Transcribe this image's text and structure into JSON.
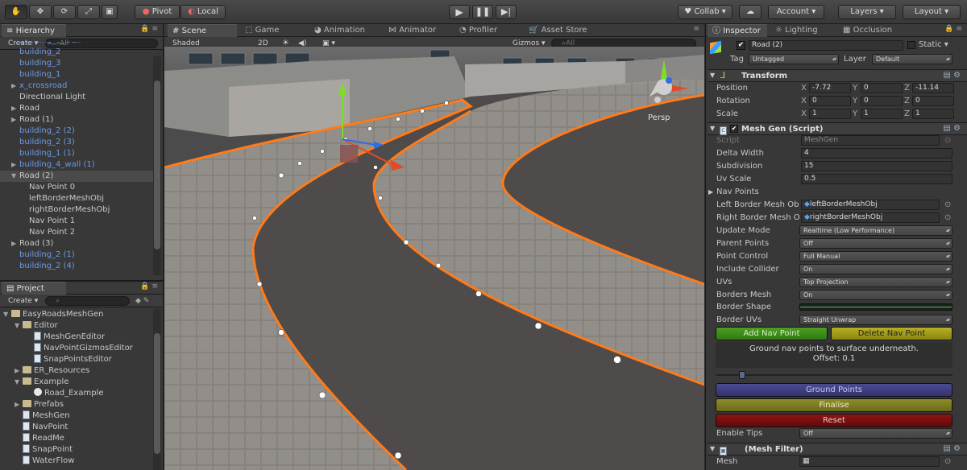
{
  "toolbar": {
    "tools": [
      "hand-icon",
      "move-icon",
      "rotate-icon",
      "scale-icon",
      "rect-icon"
    ],
    "pivot": "Pivot",
    "local": "Local",
    "collab": "Collab",
    "account": "Account",
    "layers": "Layers",
    "layout": "Layout"
  },
  "hierarchy": {
    "tab": "Hierarchy",
    "create": "Create",
    "search_placeholder": "All",
    "items": [
      {
        "label": "building_4_wall",
        "indent": 0,
        "blue": true,
        "fold": ""
      },
      {
        "label": "building_2",
        "indent": 0,
        "blue": true,
        "fold": ""
      },
      {
        "label": "building_3",
        "indent": 0,
        "blue": true,
        "fold": ""
      },
      {
        "label": "building_1",
        "indent": 0,
        "blue": true,
        "fold": ""
      },
      {
        "label": "x_crossroad",
        "indent": 0,
        "blue": true,
        "fold": "▶"
      },
      {
        "label": "Directional Light",
        "indent": 0,
        "blue": false,
        "fold": ""
      },
      {
        "label": "Road",
        "indent": 0,
        "blue": false,
        "fold": "▶"
      },
      {
        "label": "Road (1)",
        "indent": 0,
        "blue": false,
        "fold": "▶"
      },
      {
        "label": "building_2 (2)",
        "indent": 0,
        "blue": true,
        "fold": ""
      },
      {
        "label": "building_2 (3)",
        "indent": 0,
        "blue": true,
        "fold": ""
      },
      {
        "label": "building_1 (1)",
        "indent": 0,
        "blue": true,
        "fold": ""
      },
      {
        "label": "building_4_wall (1)",
        "indent": 0,
        "blue": true,
        "fold": "▶"
      },
      {
        "label": "Road (2)",
        "indent": 0,
        "blue": false,
        "fold": "▼",
        "selected": true
      },
      {
        "label": "Nav Point 0",
        "indent": 1,
        "blue": false,
        "fold": ""
      },
      {
        "label": "leftBorderMeshObj",
        "indent": 1,
        "blue": false,
        "fold": ""
      },
      {
        "label": "rightBorderMeshObj",
        "indent": 1,
        "blue": false,
        "fold": ""
      },
      {
        "label": "Nav Point 1",
        "indent": 1,
        "blue": false,
        "fold": ""
      },
      {
        "label": "Nav Point 2",
        "indent": 1,
        "blue": false,
        "fold": ""
      },
      {
        "label": "Road (3)",
        "indent": 0,
        "blue": false,
        "fold": "▶"
      },
      {
        "label": "building_2 (1)",
        "indent": 0,
        "blue": true,
        "fold": ""
      },
      {
        "label": "building_2 (4)",
        "indent": 0,
        "blue": true,
        "fold": ""
      }
    ]
  },
  "project": {
    "tab": "Project",
    "create": "Create",
    "items": [
      {
        "label": "EasyRoadsMeshGen",
        "indent": 0,
        "icon": "folder",
        "fold": "▼"
      },
      {
        "label": "Editor",
        "indent": 1,
        "icon": "folder",
        "fold": "▼"
      },
      {
        "label": "MeshGenEditor",
        "indent": 2,
        "icon": "script",
        "fold": ""
      },
      {
        "label": "NavPointGizmosEditor",
        "indent": 2,
        "icon": "script",
        "fold": ""
      },
      {
        "label": "SnapPointsEditor",
        "indent": 2,
        "icon": "script",
        "fold": ""
      },
      {
        "label": "ER_Resources",
        "indent": 1,
        "icon": "folder",
        "fold": "▶"
      },
      {
        "label": "Example",
        "indent": 1,
        "icon": "folder",
        "fold": "▼"
      },
      {
        "label": "Road_Example",
        "indent": 2,
        "icon": "unity",
        "fold": ""
      },
      {
        "label": "Prefabs",
        "indent": 1,
        "icon": "folder",
        "fold": "▶"
      },
      {
        "label": "MeshGen",
        "indent": 1,
        "icon": "script",
        "fold": ""
      },
      {
        "label": "NavPoint",
        "indent": 1,
        "icon": "script",
        "fold": ""
      },
      {
        "label": "ReadMe",
        "indent": 1,
        "icon": "script",
        "fold": ""
      },
      {
        "label": "SnapPoint",
        "indent": 1,
        "icon": "script",
        "fold": ""
      },
      {
        "label": "WaterFlow",
        "indent": 1,
        "icon": "script",
        "fold": ""
      }
    ]
  },
  "scene": {
    "tabs": [
      "Scene",
      "Game",
      "Animation",
      "Animator",
      "Profiler",
      "Asset Store"
    ],
    "shaded": "Shaded",
    "mode2d": "2D",
    "gizmos": "Gizmos",
    "search_placeholder": "All",
    "persp": "Persp"
  },
  "inspector": {
    "tabs": [
      "Inspector",
      "Lighting",
      "Occlusion"
    ],
    "object_name": "Road (2)",
    "static_label": "Static",
    "tag_label": "Tag",
    "tag_value": "Untagged",
    "layer_label": "Layer",
    "layer_value": "Default",
    "transform": {
      "title": "Transform",
      "rows": [
        {
          "label": "Position",
          "x": "-7.72",
          "y": "0",
          "z": "-11.14"
        },
        {
          "label": "Rotation",
          "x": "0",
          "y": "0",
          "z": "0"
        },
        {
          "label": "Scale",
          "x": "1",
          "y": "1",
          "z": "1"
        }
      ]
    },
    "meshgen": {
      "title": "Mesh Gen (Script)",
      "script_label": "Script",
      "script_value": "MeshGen",
      "delta_width_label": "Delta Width",
      "delta_width": "4",
      "subdivision_label": "Subdivision",
      "subdivision": "15",
      "uv_scale_label": "Uv Scale",
      "uv_scale": "0.5",
      "nav_points_label": "Nav Points",
      "left_border_label": "Left Border Mesh Ob",
      "left_border_value": "leftBorderMeshObj",
      "right_border_label": "Right Border Mesh O",
      "right_border_value": "rightBorderMeshObj",
      "dropdowns": [
        {
          "label": "Update Mode",
          "value": "Realtime (Low Performance)"
        },
        {
          "label": "Parent Points",
          "value": "Off"
        },
        {
          "label": "Point Control",
          "value": "Full Manual"
        },
        {
          "label": "Include Collider",
          "value": "On"
        },
        {
          "label": "UVs",
          "value": "Top Projection"
        },
        {
          "label": "Borders Mesh",
          "value": "On"
        }
      ],
      "border_shape_label": "Border Shape",
      "border_uvs_label": "Border UVs",
      "border_uvs_value": "Straight Unwrap",
      "add_nav": "Add Nav Point",
      "delete_nav": "Delete Nav Point",
      "help_line1": "Ground nav points to surface underneath.",
      "help_line2": "Offset: 0.1",
      "slider_value": 0.1,
      "ground_points": "Ground Points",
      "finalise": "Finalise",
      "reset": "Reset",
      "enable_tips_label": "Enable Tips",
      "enable_tips_value": "Off"
    },
    "meshfilter": {
      "title": "(Mesh Filter)",
      "mesh_label": "Mesh"
    }
  },
  "colors": {
    "accent_blue": "#6e9ae6",
    "selection_orange": "#ff7b1a",
    "add_green": "#3f8f1e",
    "delete_yellow": "#a6a018",
    "ground_purple": "#3a3a7c",
    "finalise_olive": "#7c7a22",
    "reset_red": "#7a1010"
  }
}
